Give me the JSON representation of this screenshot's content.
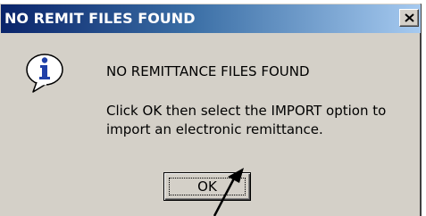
{
  "window": {
    "title": "NO REMIT FILES FOUND",
    "close_glyph": "×"
  },
  "message": {
    "icon": "information-icon",
    "heading": "NO REMITTANCE FILES FOUND",
    "body_lines": [
      "Click OK then select the IMPORT option to",
      "import an electronic remittance."
    ]
  },
  "buttons": {
    "ok_label": "OK"
  },
  "annotation": {
    "icon": "pointer-arrow-icon"
  },
  "colors": {
    "dialog_bg": "#d4d0c8",
    "titlebar_start": "#0a246a",
    "titlebar_end": "#a6caf0",
    "icon_blue": "#1f3fa8"
  }
}
